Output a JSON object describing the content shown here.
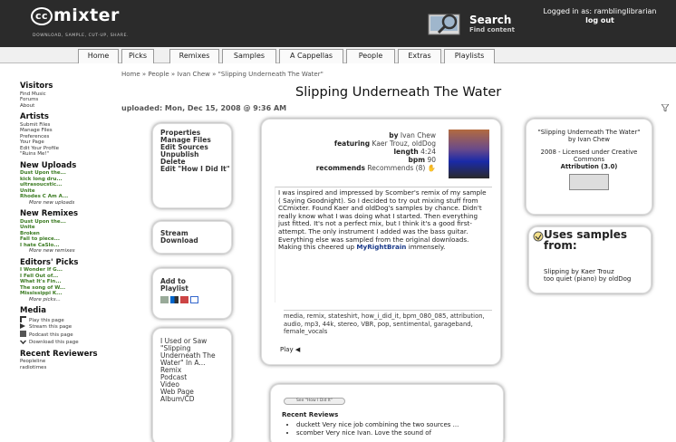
{
  "app": {
    "logo_cc": "cc",
    "logo_text": "mixter",
    "tagline": "Download, Sample, Cut-up, Share."
  },
  "search": {
    "label": "Search",
    "sub": "Find content"
  },
  "login": {
    "line1": "Logged in as: ramblinglibrarian",
    "line2": "log out"
  },
  "nav": [
    "Home",
    "Picks",
    "Remixes",
    "Samples",
    "A Cappellas",
    "People",
    "Extras",
    "Playlists"
  ],
  "sidebar": {
    "visitors": {
      "title": "Visitors",
      "items": [
        "Find Music",
        "Forums",
        "About"
      ]
    },
    "artists": {
      "title": "Artists",
      "items": [
        "Submit Files",
        "Manage Files",
        "Preferences",
        "Your Page",
        "Edit Your Profile",
        "\"Ruins Me!\""
      ]
    },
    "new_uploads": {
      "title": "New Uploads",
      "items": [
        "Dust Upon the...",
        "kick long dru...",
        "ultrasoucstic...",
        "Unite",
        "Rhodes C Am A..."
      ],
      "more": "More new uploads"
    },
    "new_remixes": {
      "title": "New Remixes",
      "items": [
        "Dust Upon the...",
        "Unite",
        "Broken",
        "Fall to piece...",
        "I hate CaSlo..."
      ],
      "more": "More new remixes"
    },
    "editors": {
      "title": "Editors' Picks",
      "items": [
        "I Wonder If G...",
        "I Fell Out of...",
        "What It's Fin...",
        "The song of W...",
        "Mississippi K..."
      ],
      "more": "More picks..."
    },
    "media": {
      "title": "Media",
      "items": [
        "Play this page",
        "Stream this page",
        "Podcast this page",
        "Download this page"
      ]
    },
    "reviewers": {
      "title": "Recent Reviewers",
      "items": [
        "Peopleline",
        "radiotimes"
      ]
    }
  },
  "breadcrumb": "Home » People » Ivan Chew » \"Slipping Underneath The Water\"",
  "page_title": "Slipping Underneath The Water",
  "uploaded": "uploaded: Mon, Dec 15, 2008 @ 9:36 AM",
  "actions": [
    "Properties",
    "Manage Files",
    "Edit Sources",
    "Unpublish",
    "Delete",
    "Edit \"How I Did It\""
  ],
  "stream": [
    "Stream",
    "Download"
  ],
  "playlist": "Add to Playlist",
  "used_in": {
    "lines": [
      "I Used or Saw",
      "\"Slipping Underneath The Water\" In A..."
    ],
    "links": [
      "Remix",
      "Podcast",
      "Video",
      "Web Page",
      "Album/CD"
    ]
  },
  "track": {
    "by_label": "by",
    "by": "Ivan Chew",
    "featuring_label": "featuring",
    "featuring": "Kaer Trouz, oldDog",
    "length_label": "length",
    "length": "4:24",
    "bpm_label": "bpm",
    "bpm": "90",
    "rec_label": "recommends",
    "rec": "Recommends (8)"
  },
  "description": {
    "p1": "I was inspired and impressed by Scomber's remix of my sample ( Saying Goodnight). So I decided to try out mixing stuff from CCmixter. Found Kaer and oldDog's samples by chance. Didn't really know what I was doing what I started. Then everything just fitted. It's not a perfect mix, but I think it's a good first-attempt. The only instrument I added was the bass guitar. Everything else was sampled from the original downloads. Making this cheered up",
    "p2": "MyRightBrain",
    "p3": "immensely."
  },
  "tags": "media, remix, stateshirt, how_i_did_it, bpm_080_085, attribution, audio, mp3, 44k, stereo, VBR, pop, sentimental, garageband, female_vocals",
  "play_label": "Play",
  "reviews": {
    "button": "See \"How I Did It\"",
    "title": "Recent Reviews",
    "items": [
      "duckett Very nice job combining the two sources ...",
      "scomber Very nice Ivan. Love the sound of"
    ]
  },
  "license": {
    "title": "\"Slipping Underneath The Water\"",
    "by": "by Ivan Chew",
    "year": "2008 - Licensed under Creative Commons",
    "type": "Attribution (3.0)"
  },
  "samples": {
    "title": "Uses samples from:",
    "items": [
      "Slipping by Kaer Trouz",
      "too quiet (piano) by oldDog"
    ]
  },
  "colors": {
    "header": "#2b2b2b",
    "link": "#3a7a20"
  }
}
